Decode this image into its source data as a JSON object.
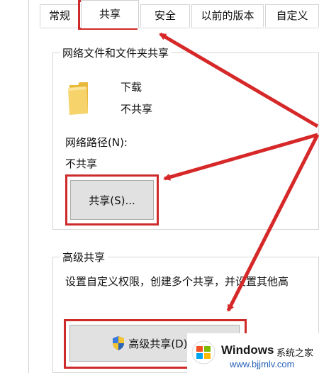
{
  "tabs": [
    {
      "label": "常规"
    },
    {
      "label": "共享"
    },
    {
      "label": "安全"
    },
    {
      "label": "以前的版本"
    },
    {
      "label": "自定义"
    }
  ],
  "network_sharing": {
    "title": "网络文件和文件夹共享",
    "folder_name": "下载",
    "folder_status": "不共享",
    "path_label": "网络路径(N):",
    "path_value": "不共享",
    "share_button": "共享(S)..."
  },
  "advanced_sharing": {
    "title": "高级共享",
    "description": "设置自定义权限，创建多个共享，并设置其他高",
    "button": "高级共享(D)..."
  },
  "watermark": {
    "brand": "Windows",
    "brand_suffix": "系统之家",
    "url": "www.bjjmlv.com"
  },
  "colors": {
    "highlight": "#cf2a2a",
    "folder": "#f2c94c"
  },
  "icons": {
    "folder": "folder-icon",
    "uac_shield": "shield-icon",
    "windows_logo": "windows-logo-icon"
  }
}
